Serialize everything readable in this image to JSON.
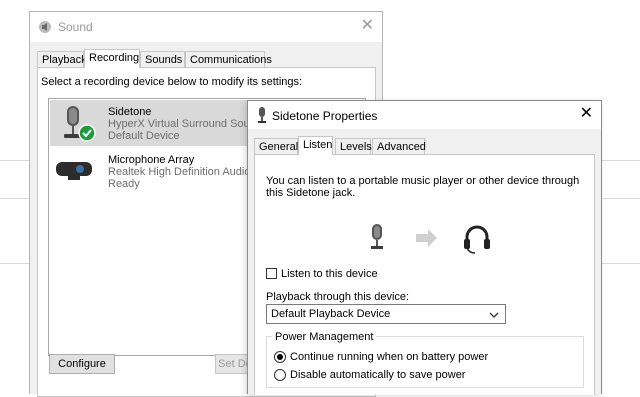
{
  "sound_window": {
    "title": "Sound",
    "close_glyph": "✕",
    "tabs": [
      {
        "label": "Playback",
        "active": false
      },
      {
        "label": "Recording",
        "active": true
      },
      {
        "label": "Sounds",
        "active": false
      },
      {
        "label": "Communications",
        "active": false
      }
    ],
    "instruction": "Select a recording device below to modify its settings:",
    "devices": [
      {
        "name": "Sidetone",
        "sub": "HyperX Virtual Surround Sound",
        "state": "Default Device",
        "icon": "microphone-icon",
        "selected": true,
        "default_badge": "check-badge-icon"
      },
      {
        "name": "Microphone Array",
        "sub": "Realtek High Definition Audio",
        "state": "Ready",
        "icon": "webcam-microphone-icon",
        "selected": false
      }
    ],
    "configure_label": "Configure",
    "set_default_label": "Set De"
  },
  "props_window": {
    "title": "Sidetone Properties",
    "close_glyph": "✕",
    "tabs": [
      {
        "label": "General",
        "active": false
      },
      {
        "label": "Listen",
        "active": true
      },
      {
        "label": "Levels",
        "active": false
      },
      {
        "label": "Advanced",
        "active": false
      }
    ],
    "description": "You can listen to a portable music player or other device through this Sidetone jack.",
    "listen_checkbox": {
      "label": "Listen to this device",
      "checked": false
    },
    "playback_label": "Playback through this device:",
    "playback_select": {
      "value": "Default Playback Device"
    },
    "power_group": {
      "title": "Power Management",
      "options": [
        {
          "label": "Continue running when on battery power",
          "selected": true
        },
        {
          "label": "Disable automatically to save power",
          "selected": false
        }
      ]
    }
  },
  "colors": {
    "accent_green": "#1e9b3c",
    "selection_gray": "#d9d9d9",
    "disabled_text": "#9a9a9a"
  }
}
